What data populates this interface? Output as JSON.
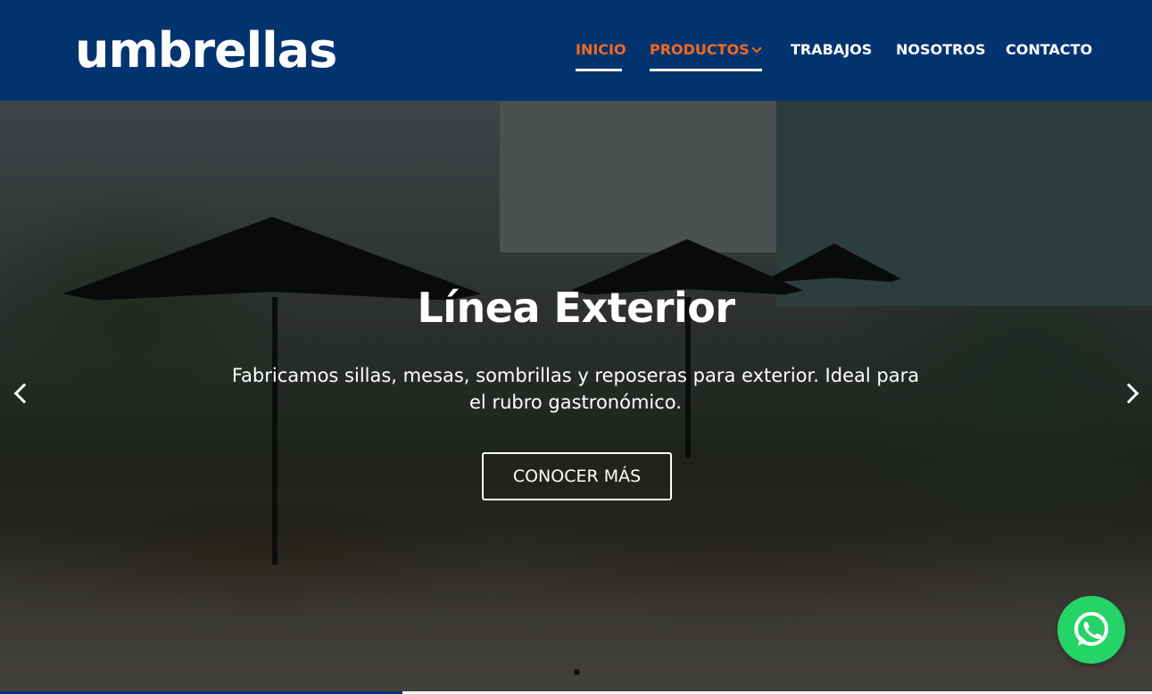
{
  "brand": {
    "logo_text": "umbrellas"
  },
  "nav": {
    "items": [
      {
        "label": "INICIO"
      },
      {
        "label": "PRODUCTOS"
      },
      {
        "label": "TRABAJOS"
      },
      {
        "label": "NOSOTROS"
      },
      {
        "label": "CONTACTO"
      }
    ],
    "active_color": "#f26a20",
    "header_color": "#04346f"
  },
  "hero": {
    "title": "Línea Exterior",
    "subtitle": "Fabricamos sillas, mesas, sombrillas y reposeras para exterior. Ideal para el rubro gastronómico.",
    "button_label": "CONOCER MÁS",
    "prev_icon": "chevron-left-icon",
    "next_icon": "chevron-right-icon"
  },
  "whatsapp": {
    "icon": "whatsapp-icon",
    "color": "#25d366"
  }
}
